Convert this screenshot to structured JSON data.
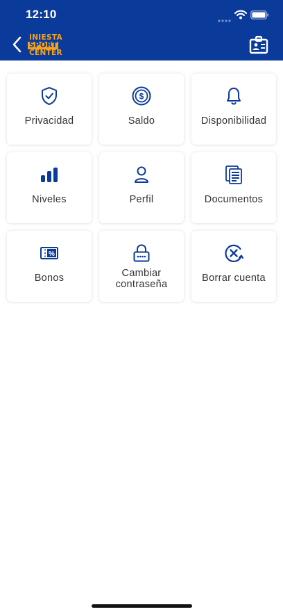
{
  "status_bar": {
    "time": "12:10"
  },
  "header": {
    "logo_lines": [
      "INIESTA",
      "SPORT",
      "CENTER"
    ]
  },
  "colors": {
    "primary": "#0a3a9a",
    "accent": "#f7a21b",
    "icon": "#0a3a9a"
  },
  "menu": [
    {
      "label": "Privacidad",
      "icon": "shield-check-icon"
    },
    {
      "label": "Saldo",
      "icon": "dollar-coin-icon"
    },
    {
      "label": "Disponibilidad",
      "icon": "bell-icon"
    },
    {
      "label": "Niveles",
      "icon": "bar-chart-icon"
    },
    {
      "label": "Perfil",
      "icon": "user-icon"
    },
    {
      "label": "Documentos",
      "icon": "documents-icon"
    },
    {
      "label": "Bonos",
      "icon": "ticket-percent-icon"
    },
    {
      "label": "Cambiar contraseña",
      "icon": "lock-icon"
    },
    {
      "label": "Borrar cuenta",
      "icon": "delete-account-icon"
    }
  ]
}
